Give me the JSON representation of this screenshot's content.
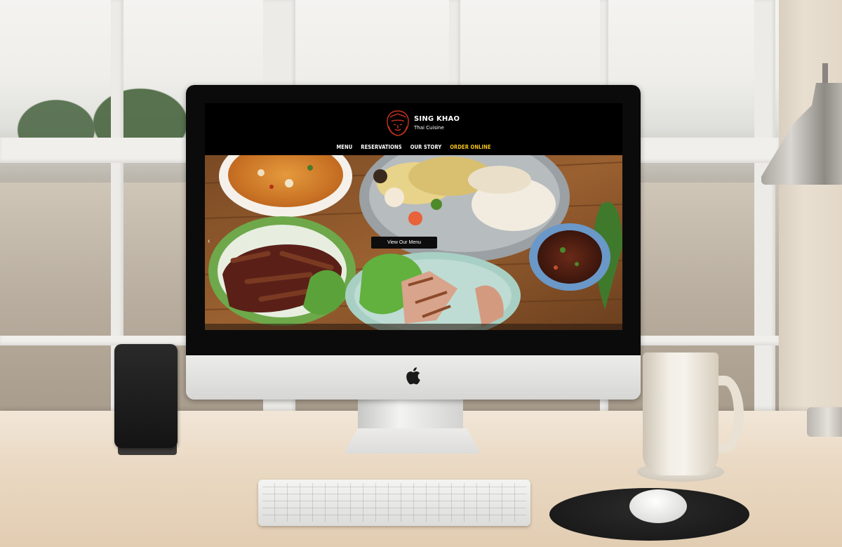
{
  "site": {
    "brand": {
      "name": "SING KHAO",
      "tagline": "Thai Cuisine",
      "logo_icon": "lion-head-icon",
      "logo_color": "#c8321e"
    },
    "nav": {
      "items": [
        {
          "label": "MENU",
          "accent": false
        },
        {
          "label": "RESERVATIONS",
          "accent": false
        },
        {
          "label": "OUR STORY",
          "accent": false
        },
        {
          "label": "ORDER ONLINE",
          "accent": true
        }
      ],
      "accent_color": "#f3c21b"
    },
    "hero": {
      "button_label": "View Our Menu",
      "prev_arrow": "‹",
      "prev_icon": "chevron-left-icon"
    }
  },
  "device": {
    "brand_icon": "apple-logo-icon",
    "apple_glyph": ""
  }
}
